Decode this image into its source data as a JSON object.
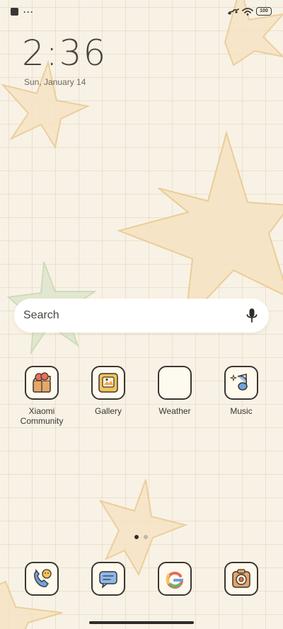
{
  "status_bar": {
    "battery_level": "100",
    "icons": [
      "notification-square-icon",
      "more-dots-icon",
      "signal-icon",
      "wifi-icon",
      "battery-icon"
    ]
  },
  "lock": {
    "time": "2:36",
    "date": "Sun, January 14"
  },
  "search": {
    "placeholder": "Search"
  },
  "apps": [
    {
      "label": "Xiaomi\nCommunity",
      "icon": "xiaomi-community-icon"
    },
    {
      "label": "Gallery",
      "icon": "gallery-icon"
    },
    {
      "label": "Weather",
      "icon": "weather-icon"
    },
    {
      "label": "Music",
      "icon": "music-icon"
    }
  ],
  "dock": [
    {
      "icon": "phone-icon"
    },
    {
      "icon": "messages-icon"
    },
    {
      "icon": "google-icon"
    },
    {
      "icon": "camera-icon"
    }
  ],
  "pager": {
    "current_page": 1,
    "total_pages": 2
  },
  "colors": {
    "background": "#f8f2e6",
    "star_fill": "#f6e3c4",
    "star_stroke": "#e9c98f",
    "green_star": "#c9d8b4",
    "text_dark": "#3a3630"
  }
}
